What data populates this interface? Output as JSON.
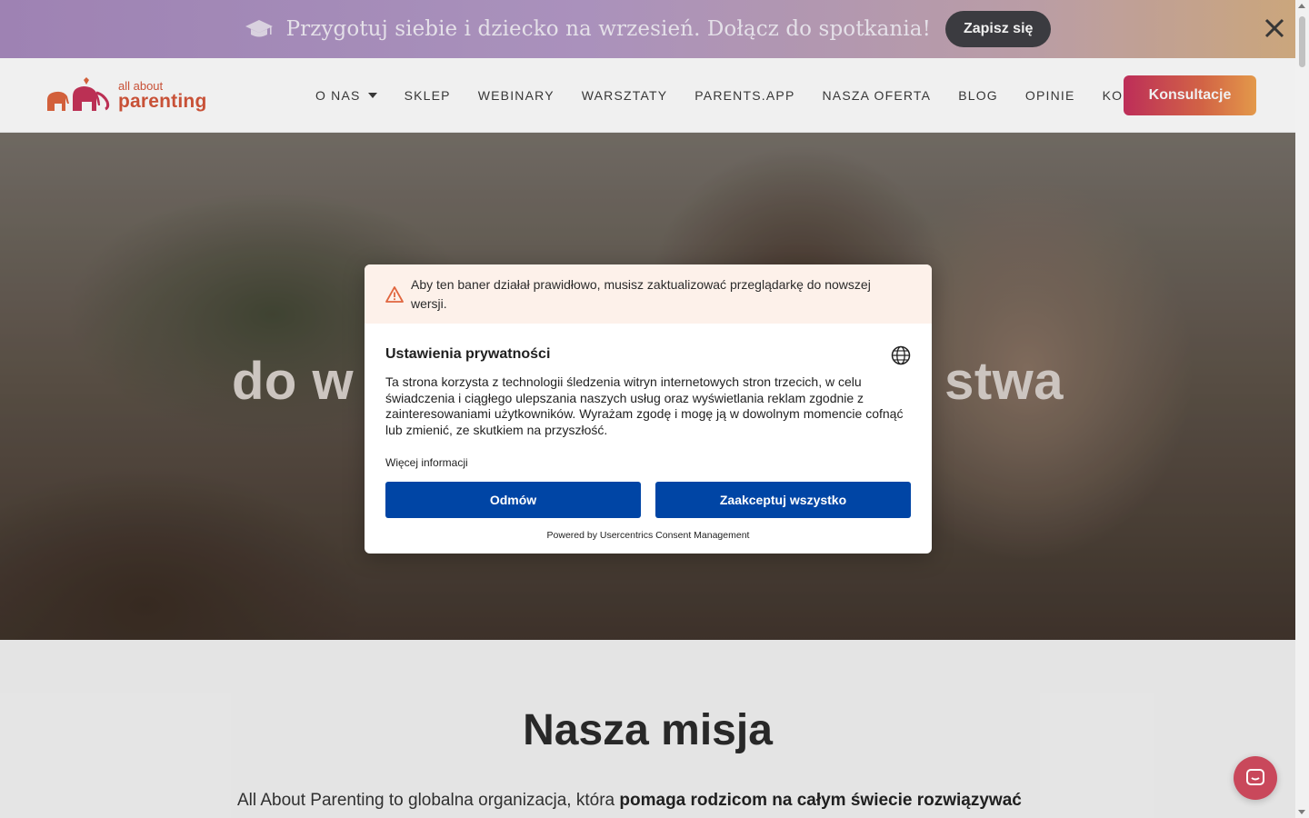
{
  "topbar": {
    "icon": "graduation-cap-icon",
    "message": "Przygotuj siebie i dziecko na wrzesień. Dołącz do spotkania!",
    "signup_label": "Zapisz się",
    "close_icon": "close-icon"
  },
  "header": {
    "logo": {
      "line1": "all about",
      "line2": "parenting"
    },
    "nav": [
      {
        "label": "O NAS",
        "has_dropdown": true
      },
      {
        "label": "SKLEP"
      },
      {
        "label": "WEBINARY"
      },
      {
        "label": "WARSZTATY"
      },
      {
        "label": "PARENTS.APP"
      },
      {
        "label": "NASZA OFERTA"
      },
      {
        "label": "BLOG"
      },
      {
        "label": "OPINIE"
      },
      {
        "label": "KONTAKT"
      }
    ],
    "cta_label": "Konsultacje"
  },
  "hero": {
    "headline_left": "do w",
    "headline_right": "stwa"
  },
  "mission": {
    "title": "Nasza misja",
    "body_plain": "All About Parenting to globalna organizacja, która ",
    "body_bold": "pomaga rodzicom na całym świecie rozwiązywać"
  },
  "consent": {
    "warning": "Aby ten baner działał prawidłowo, musisz zaktualizować przeglądarkę do nowszej wersji.",
    "title": "Ustawienia prywatności",
    "description": "Ta strona korzysta z technologii śledzenia witryn internetowych stron trzecich, w celu świadczenia i ciągłego ulepszania naszych usług oraz wyświetlania reklam zgodnie z zainteresowaniami użytkowników. Wyrażam zgodę i mogę ją w dowolnym momencie cofnąć lub zmienić, ze skutkiem na przyszłość.",
    "more_info": "Więcej informacji",
    "deny_label": "Odmów",
    "accept_label": "Zaakceptuj wszystko",
    "powered_by": "Powered by Usercentrics Consent Management"
  },
  "colors": {
    "accent_blue": "#0045a5",
    "cta_gradient_start": "#c9315f",
    "cta_gradient_end": "#f2a34f",
    "warning_bg": "#fdf1ea"
  }
}
